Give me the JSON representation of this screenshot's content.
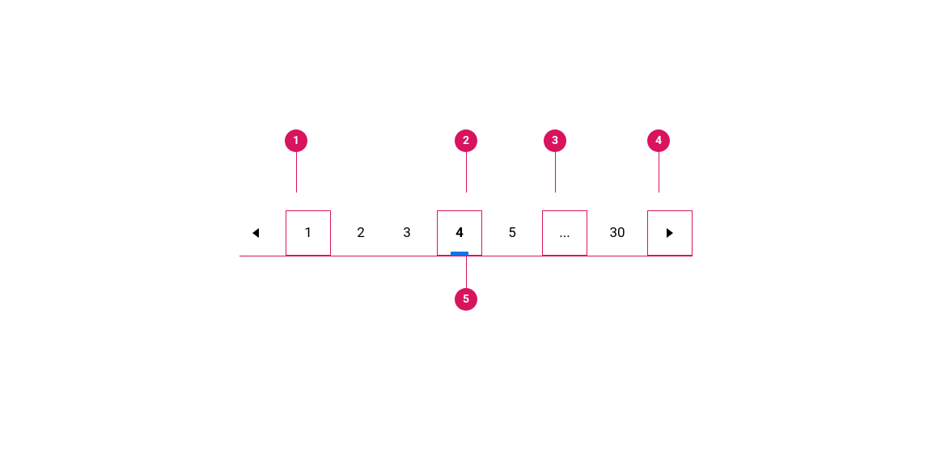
{
  "colors": {
    "accent": "#d8145f",
    "indicator": "#1473e6"
  },
  "pagination": {
    "prev": "◀",
    "next": "▶",
    "first": "1",
    "p2": "2",
    "p3": "3",
    "current": "4",
    "p5": "5",
    "ellipsis": "...",
    "last": "30"
  },
  "callouts": {
    "c1": "1",
    "c2": "2",
    "c3": "3",
    "c4": "4",
    "c5": "5"
  }
}
